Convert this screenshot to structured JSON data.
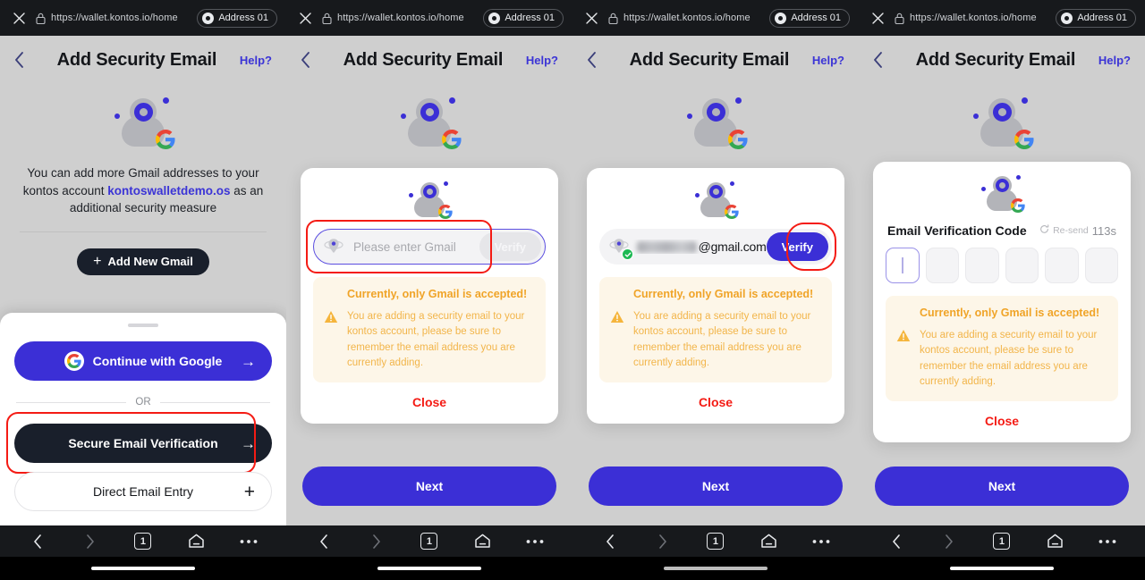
{
  "browser": {
    "url": "https://wallet.kontos.io/home",
    "address_pill": "Address 01",
    "close_icon": "close-icon",
    "lock_icon": "lock-icon"
  },
  "nav": {
    "back_icon": "chevron-left-icon",
    "forward_icon": "chevron-right-icon",
    "tab_count": "1",
    "home_icon": "home-icon",
    "menu_icon": "more-horizontal-icon"
  },
  "app": {
    "title": "Add Security Email",
    "help_label": "Help?",
    "back_icon": "chevron-left-icon",
    "next_label": "Next"
  },
  "panel1": {
    "description_pre": "You can add more Gmail addresses to your kontos account ",
    "account": "kontoswalletdemo.os",
    "description_post": " as an additional security measure",
    "add_new_gmail_label": "Add New Gmail",
    "sheet": {
      "google_label": "Continue with Google",
      "or_label": "OR",
      "secure_label": "Secure Email Verification",
      "direct_label": "Direct Email Entry"
    }
  },
  "panel2": {
    "gmail_placeholder": "Please enter Gmail",
    "verify_label": "Verify",
    "warn_title": "Currently, only Gmail is accepted!",
    "warn_text": "You are adding a security email to your kontos account, please be sure to remember the email address you are currently adding.",
    "close_label": "Close"
  },
  "panel3": {
    "gmail_domain": "@gmail.com",
    "verify_label": "Verify",
    "warn_title": "Currently, only Gmail is accepted!",
    "warn_text": "You are adding a security email to your kontos account, please be sure to remember the email address you are currently adding.",
    "close_label": "Close"
  },
  "panel4": {
    "otp_title": "Email Verification Code",
    "resend_label": "Re-send",
    "resend_seconds": "113s",
    "otp_cells": [
      "",
      "",
      "",
      "",
      "",
      ""
    ],
    "warn_title": "Currently, only Gmail is accepted!",
    "warn_text": "You are adding a security email to your kontos account, please be sure to remember the email address you are currently adding.",
    "close_label": "Close"
  },
  "colors": {
    "brand_purple": "#3b2fd6",
    "dark_button": "#191f2b",
    "warning_amber": "#f0a428",
    "warning_bg": "#fdf6e8",
    "close_red": "#f41b14",
    "highlight_red": "#f41b14",
    "page_bg": "#cfcfcf",
    "chrome_bg": "#17191c"
  }
}
